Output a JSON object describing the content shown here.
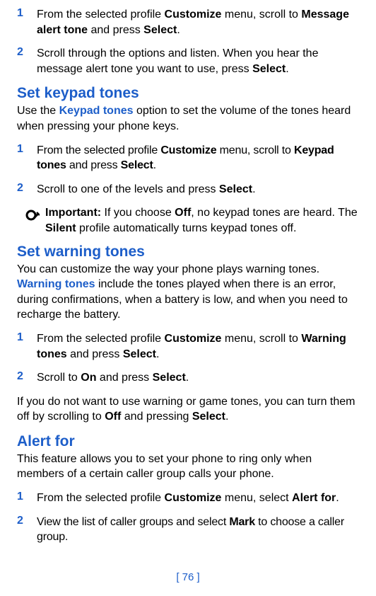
{
  "section1": {
    "step1_num": "1",
    "step1_a": "From the selected profile ",
    "step1_b": "Customize",
    "step1_c": " menu, scroll to ",
    "step1_d": "Message alert tone",
    "step1_e": " and press ",
    "step1_f": "Select",
    "step1_g": ".",
    "step2_num": "2",
    "step2_a": "Scroll through the options and listen. When you hear the message alert tone you want to use, press ",
    "step2_b": "Select",
    "step2_c": "."
  },
  "keypad": {
    "heading": "Set keypad tones",
    "intro_a": "Use the ",
    "intro_b": "Keypad tones",
    "intro_c": " option to set the volume of the tones heard when pressing your phone keys.",
    "step1_num": "1",
    "step1_a": "From the selected profile ",
    "step1_b": "Customize",
    "step1_c": " menu, scroll to ",
    "step1_d": "Keypad tones",
    "step1_e": " and press ",
    "step1_f": "Select",
    "step1_g": ".",
    "step2_num": "2",
    "step2_a": "Scroll to one of the levels and press ",
    "step2_b": "Select",
    "step2_c": ".",
    "important_a": "Important:",
    "important_b": " If you choose ",
    "important_c": "Off",
    "important_d": ", no keypad tones are heard. The ",
    "important_e": "Silent",
    "important_f": " profile automatically turns keypad tones off."
  },
  "warning": {
    "heading": "Set warning tones",
    "intro_a": "You can customize the way your phone plays warning tones. ",
    "intro_b": "Warning tones",
    "intro_c": " include the tones played when there is an error, during confirmations, when a battery is low, and when you need to recharge the battery.",
    "step1_num": "1",
    "step1_a": "From the selected profile ",
    "step1_b": "Customize",
    "step1_c": " menu, scroll to ",
    "step1_d": "Warning tones",
    "step1_e": " and press ",
    "step1_f": "Select",
    "step1_g": ".",
    "step2_num": "2",
    "step2_a": "Scroll to ",
    "step2_b": "On",
    "step2_c": " and press ",
    "step2_d": "Select",
    "step2_e": ".",
    "outro_a": "If you do not want to use warning or game tones, you can turn them off by scrolling to ",
    "outro_b": "Off",
    "outro_c": " and pressing ",
    "outro_d": "Select",
    "outro_e": "."
  },
  "alertfor": {
    "heading": "Alert for",
    "intro": "This feature allows you to set your phone to ring only when members of a certain caller group calls your phone.",
    "step1_num": "1",
    "step1_a": "From the selected profile ",
    "step1_b": "Customize",
    "step1_c": " menu, select ",
    "step1_d": "Alert for",
    "step1_e": ".",
    "step2_num": "2",
    "step2_a": "View the list of caller groups and select ",
    "step2_b": "Mark",
    "step2_c": " to choose a caller group."
  },
  "footer": "[ 76 ]"
}
